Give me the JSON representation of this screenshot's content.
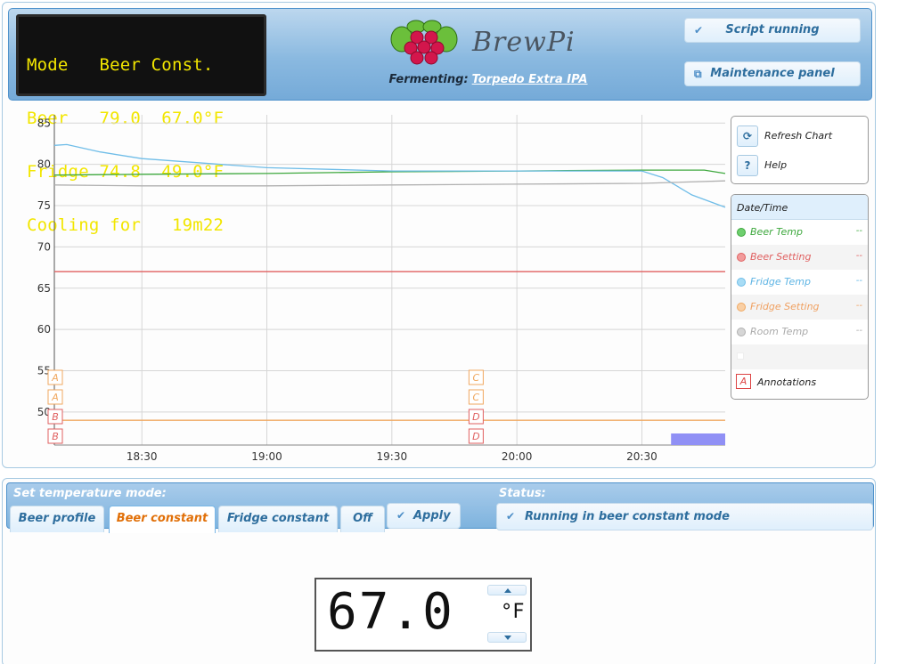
{
  "lcd": {
    "line1": "Mode   Beer Const.",
    "line2": "Beer   79.0  67.0°F",
    "line3": "Fridge 74.8  49.0°F",
    "line4": "Cooling for   19m22"
  },
  "header": {
    "brand": "BrewPi",
    "fermenting_label": "Fermenting:",
    "beer_name": "Torpedo Extra IPA",
    "script_button": "Script running",
    "maintenance_button": "Maintenance panel"
  },
  "chart_controls": {
    "refresh": "Refresh Chart",
    "help": "Help",
    "help_icon": "?"
  },
  "legend": {
    "date_time": "Date/Time",
    "items": [
      {
        "label": "Beer Temp",
        "value": "--",
        "color": "#4caf50"
      },
      {
        "label": "Beer Setting",
        "value": "--",
        "color": "#e57373"
      },
      {
        "label": "Fridge Temp",
        "value": "--",
        "color": "#7ec8ee"
      },
      {
        "label": "Fridge Setting",
        "value": "--",
        "color": "#f5b27a"
      },
      {
        "label": "Room Temp",
        "value": "--",
        "color": "#bbbbbb"
      }
    ],
    "annotations_icon": "A",
    "annotations_label": "Annotations"
  },
  "chart_data": {
    "type": "line",
    "x_ticks": [
      "18:30",
      "19:00",
      "19:30",
      "20:00",
      "20:30"
    ],
    "y_ticks": [
      50,
      55,
      60,
      65,
      70,
      75,
      80,
      85
    ],
    "ylim": [
      46,
      86
    ],
    "xlim": [
      "18:09",
      "20:50"
    ],
    "grid": true,
    "series": [
      {
        "name": "Beer Temp",
        "color": "#3ea83e",
        "x": [
          "18:09",
          "18:30",
          "19:00",
          "19:30",
          "20:00",
          "20:30",
          "20:45",
          "20:50"
        ],
        "y": [
          78.7,
          78.8,
          78.9,
          79.1,
          79.2,
          79.3,
          79.3,
          78.9
        ]
      },
      {
        "name": "Beer Setting",
        "color": "#e06060",
        "x": [
          "18:09",
          "20:50"
        ],
        "y": [
          67.0,
          67.0
        ]
      },
      {
        "name": "Fridge Temp",
        "color": "#6fbde8",
        "x": [
          "18:09",
          "18:12",
          "18:20",
          "18:30",
          "19:00",
          "19:30",
          "20:00",
          "20:30",
          "20:35",
          "20:42",
          "20:50"
        ],
        "y": [
          82.3,
          82.4,
          81.5,
          80.7,
          79.6,
          79.2,
          79.2,
          79.2,
          78.4,
          76.3,
          74.8
        ]
      },
      {
        "name": "Fridge Setting",
        "color": "#f0a860",
        "x": [
          "18:09",
          "20:50"
        ],
        "y": [
          49.0,
          49.0
        ]
      },
      {
        "name": "Room Temp",
        "color": "#b0b0b0",
        "x": [
          "18:09",
          "18:30",
          "19:00",
          "19:30",
          "20:00",
          "20:30",
          "20:50"
        ],
        "y": [
          77.5,
          77.4,
          77.4,
          77.5,
          77.6,
          77.7,
          78.0
        ]
      }
    ],
    "annotations": [
      {
        "label": "A",
        "x": "18:09",
        "series": "Beer Setting"
      },
      {
        "label": "A",
        "x": "18:09",
        "series": "Fridge Setting"
      },
      {
        "label": "B",
        "x": "18:09",
        "series": "Beer Setting"
      },
      {
        "label": "B",
        "x": "18:09",
        "series": "Fridge Setting"
      },
      {
        "label": "C",
        "x": "19:50",
        "series": "Beer Setting"
      },
      {
        "label": "C",
        "x": "19:50",
        "series": "Fridge Setting"
      },
      {
        "label": "D",
        "x": "19:50",
        "series": "Beer Setting"
      },
      {
        "label": "D",
        "x": "19:50",
        "series": "Fridge Setting"
      }
    ],
    "state_band": {
      "from": "20:37",
      "to": "20:50",
      "color": "#9090f5"
    }
  },
  "mode_panel": {
    "title": "Set temperature mode:",
    "status_title": "Status:",
    "tabs": [
      "Beer profile",
      "Beer constant",
      "Fridge constant",
      "Off"
    ],
    "active_tab": "Beer constant",
    "apply": "Apply",
    "status": "Running in beer constant mode",
    "setpoint": "67.0",
    "unit": "°F"
  }
}
